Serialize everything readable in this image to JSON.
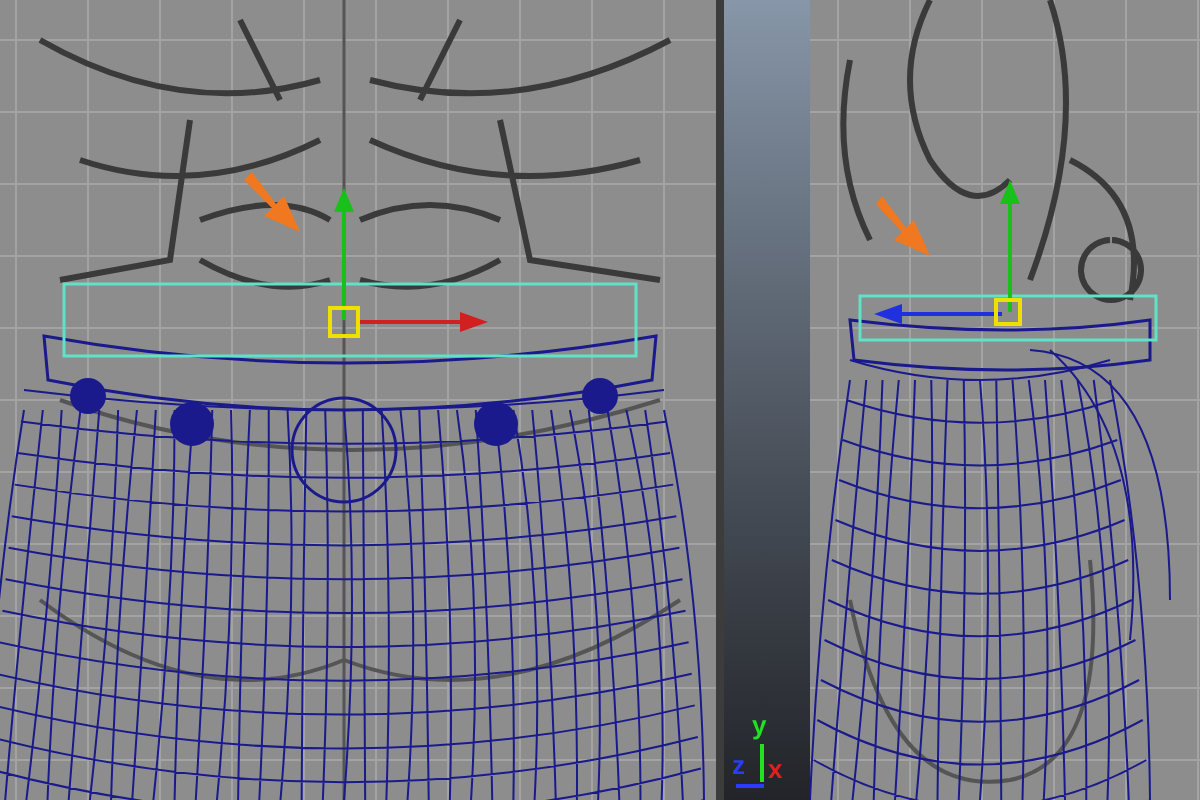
{
  "axis_gizmo": [
    {
      "label": "y",
      "color": "#22e022"
    },
    {
      "label": "z",
      "color": "#2a3cff"
    },
    {
      "label": "x",
      "color": "#e02020"
    }
  ]
}
